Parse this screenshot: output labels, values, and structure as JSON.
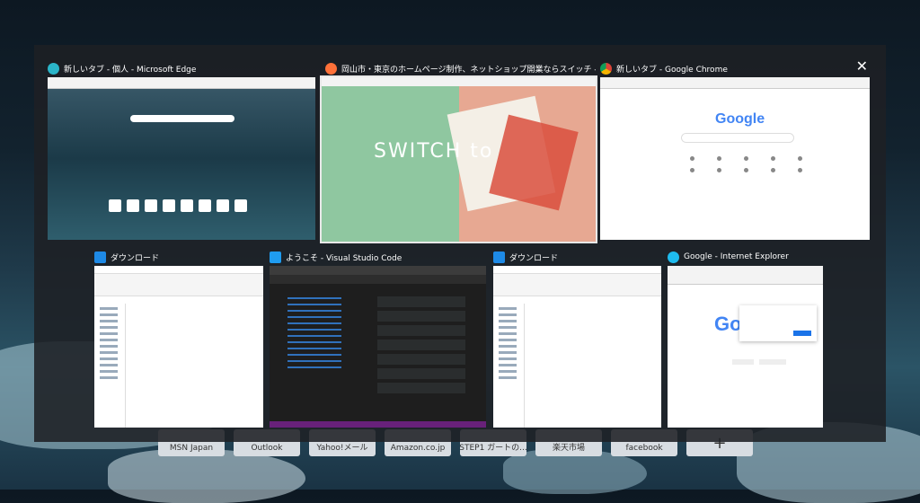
{
  "close_symbol": "✕",
  "windows": [
    {
      "title": "新しいタブ - 個人 - Microsoft Edge",
      "icon": "edge-icon",
      "color": "#2bb5c9",
      "selected": false
    },
    {
      "title": "岡山市・東京のホームページ制作、ネットショップ開業ならスイッチ - Mozilla Firefox",
      "icon": "firefox-icon",
      "color": "#ff7139",
      "selected": true,
      "page_heading": "SWITCH to"
    },
    {
      "title": "新しいタブ - Google Chrome",
      "icon": "chrome-icon",
      "color": "#db4437",
      "selected": false,
      "page_heading": "Google"
    },
    {
      "title": "ダウンロード",
      "icon": "download-icon",
      "color": "#1e8ae6",
      "selected": false
    },
    {
      "title": "ようこそ - Visual Studio Code",
      "icon": "vscode-icon",
      "color": "#1f9cf0",
      "selected": false
    },
    {
      "title": "ダウンロード",
      "icon": "download-icon",
      "color": "#1e8ae6",
      "selected": false
    },
    {
      "title": "Google - Internet Explorer",
      "icon": "ie-icon",
      "color": "#1ebbee",
      "selected": false,
      "page_heading": "Go"
    }
  ],
  "speed_dial": [
    "MSN Japan",
    "Outlook",
    "Yahoo!メール",
    "Amazon.co.jp",
    "STEP1 ガートの...",
    "楽天市場",
    "facebook",
    "+"
  ]
}
